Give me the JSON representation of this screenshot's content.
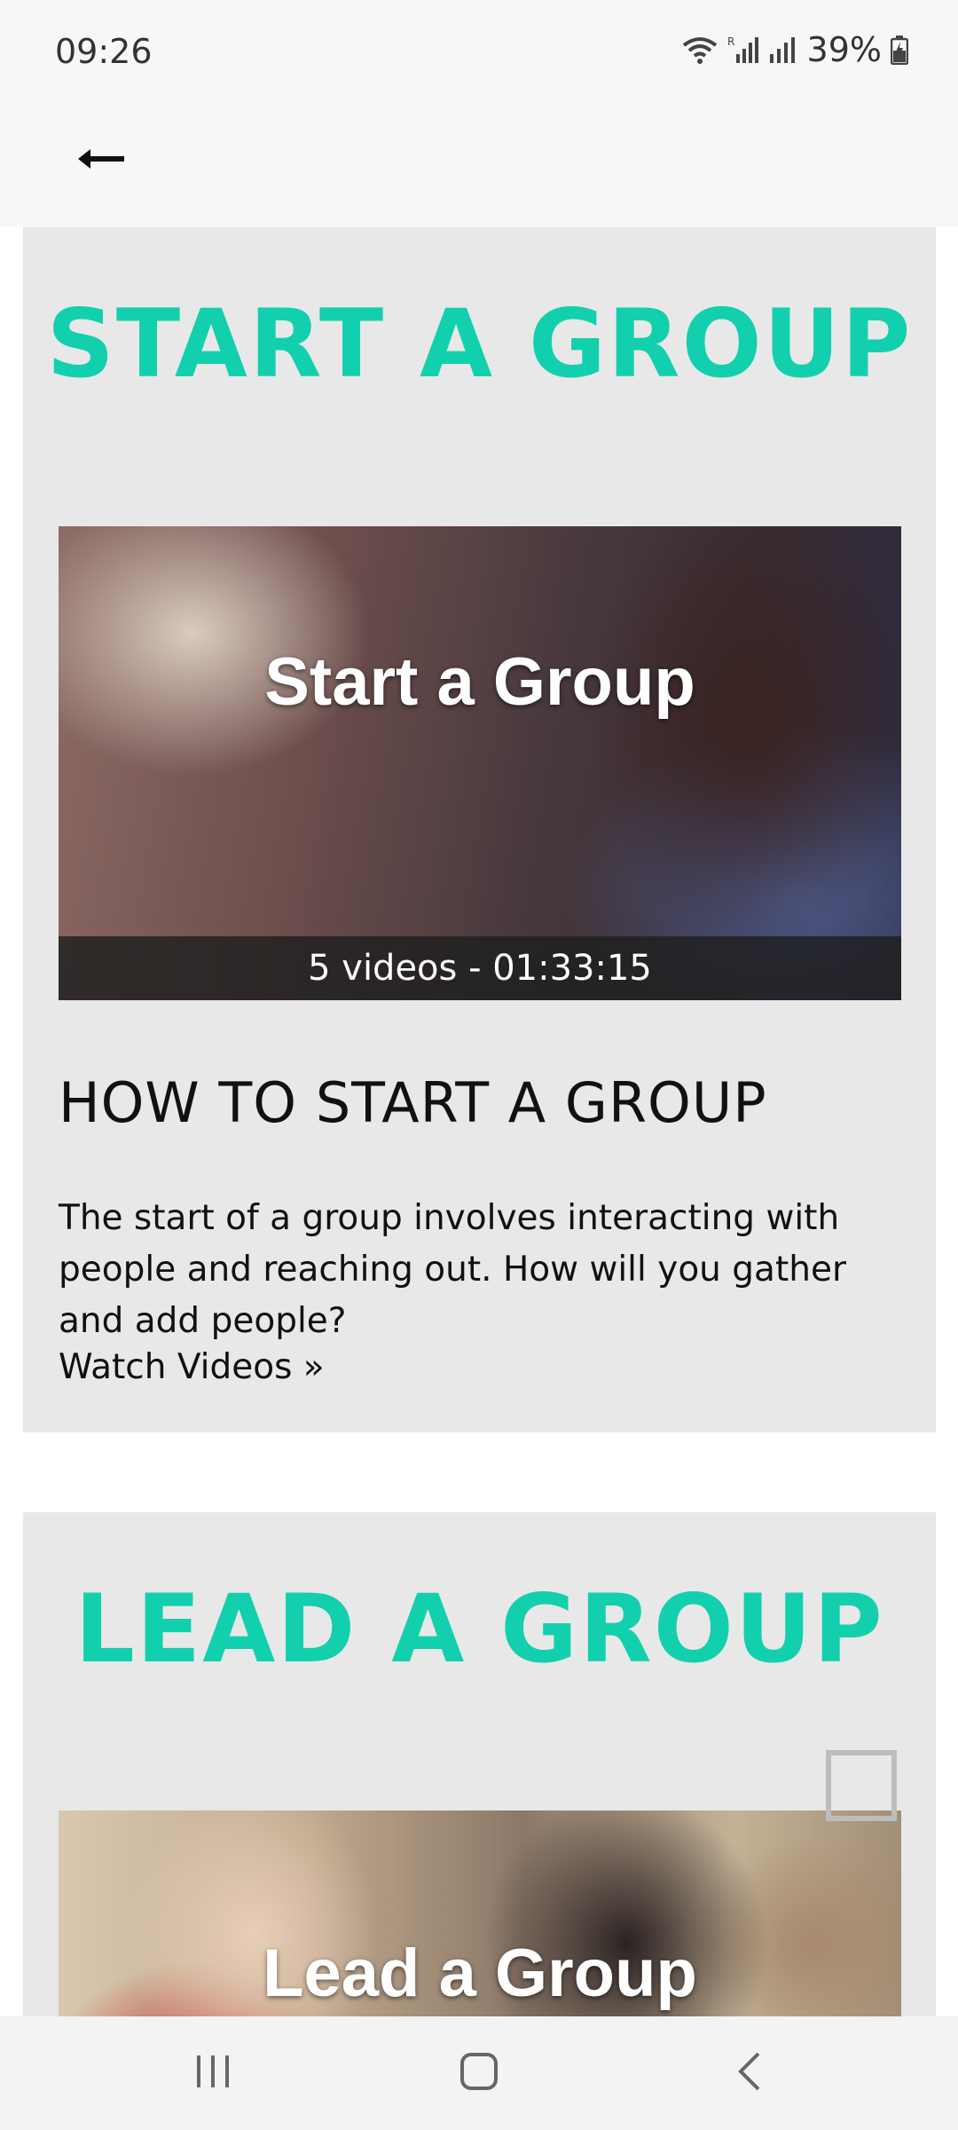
{
  "status_bar": {
    "time": "09:26",
    "battery": "39%"
  },
  "cards": [
    {
      "heading": "START A GROUP",
      "thumbnail_title": "Start a Group",
      "thumbnail_caption": "5 videos - 01:33:15",
      "section_title": "HOW TO START A GROUP",
      "description": "The start of a group involves interacting with people and reaching out. How will you gather and add people?",
      "link_label": "Watch Videos »"
    },
    {
      "heading": "LEAD A GROUP",
      "thumbnail_title": "Lead a Group"
    }
  ],
  "colors": {
    "accent": "#12d0ad",
    "card_background": "#e8e8e8"
  },
  "icons": {
    "back": "arrow-left-icon",
    "wifi": "wifi-icon",
    "signal": "signal-icon",
    "battery": "battery-icon",
    "recents": "recents-icon",
    "home": "home-icon",
    "nav_back": "chevron-left-icon"
  }
}
